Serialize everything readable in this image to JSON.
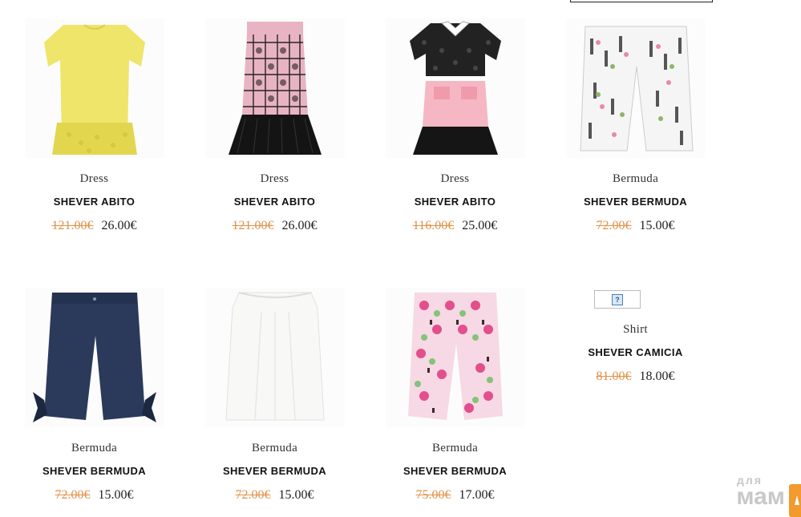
{
  "products": [
    {
      "category": "Dress",
      "name": "SHEVER ABITO",
      "old_price": "121.00€",
      "price": "26.00€",
      "image": "yellow-dress"
    },
    {
      "category": "Dress",
      "name": "SHEVER ABITO",
      "old_price": "121.00€",
      "price": "26.00€",
      "image": "lace-pink-dress"
    },
    {
      "category": "Dress",
      "name": "SHEVER ABITO",
      "old_price": "116.00€",
      "price": "25.00€",
      "image": "pink-collar-dress"
    },
    {
      "category": "Bermuda",
      "name": "SHEVER BERMUDA",
      "old_price": "72.00€",
      "price": "15.00€",
      "image": "printed-shorts"
    },
    {
      "category": "Bermuda",
      "name": "SHEVER BERMUDA",
      "old_price": "72.00€",
      "price": "15.00€",
      "image": "navy-culottes"
    },
    {
      "category": "Bermuda",
      "name": "SHEVER BERMUDA",
      "old_price": "72.00€",
      "price": "15.00€",
      "image": "white-culottes"
    },
    {
      "category": "Bermuda",
      "name": "SHEVER BERMUDA",
      "old_price": "75.00€",
      "price": "17.00€",
      "image": "floral-culottes"
    },
    {
      "category": "Shirt",
      "name": "SHEVER CAMICIA",
      "old_price": "81.00€",
      "price": "18.00€",
      "image": "broken-image"
    }
  ],
  "watermark": {
    "small": "для",
    "big": "мам"
  },
  "colors": {
    "old_price": "#e0924a",
    "accent": "#f29a2e"
  }
}
